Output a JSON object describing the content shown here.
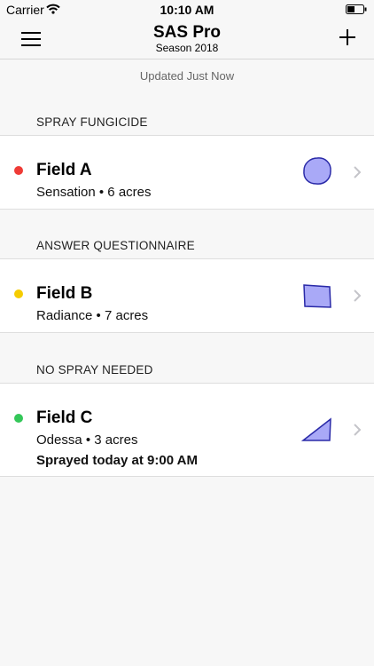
{
  "status_bar": {
    "carrier": "Carrier",
    "time": "10:10 AM"
  },
  "header": {
    "title": "SAS Pro",
    "subtitle": "Season 2018"
  },
  "updated_text": "Updated Just Now",
  "sections": [
    {
      "title": "SPRAY FUNGICIDE",
      "field": {
        "name": "Field A",
        "detail": "Sensation • 6 acres",
        "status_color": "#ef3b36",
        "shape": "circle"
      }
    },
    {
      "title": "ANSWER QUESTIONNAIRE",
      "field": {
        "name": "Field B",
        "detail": "Radiance • 7 acres",
        "status_color": "#f5cc00",
        "shape": "quadrilateral"
      }
    },
    {
      "title": "NO SPRAY NEEDED",
      "field": {
        "name": "Field C",
        "detail": "Odessa • 3 acres",
        "extra": "Sprayed today at 9:00 AM",
        "status_color": "#34c759",
        "shape": "triangle"
      }
    }
  ],
  "colors": {
    "shape_fill": "#a9a9f7",
    "shape_stroke": "#2a2aa8",
    "chevron": "#c4c4c9"
  }
}
